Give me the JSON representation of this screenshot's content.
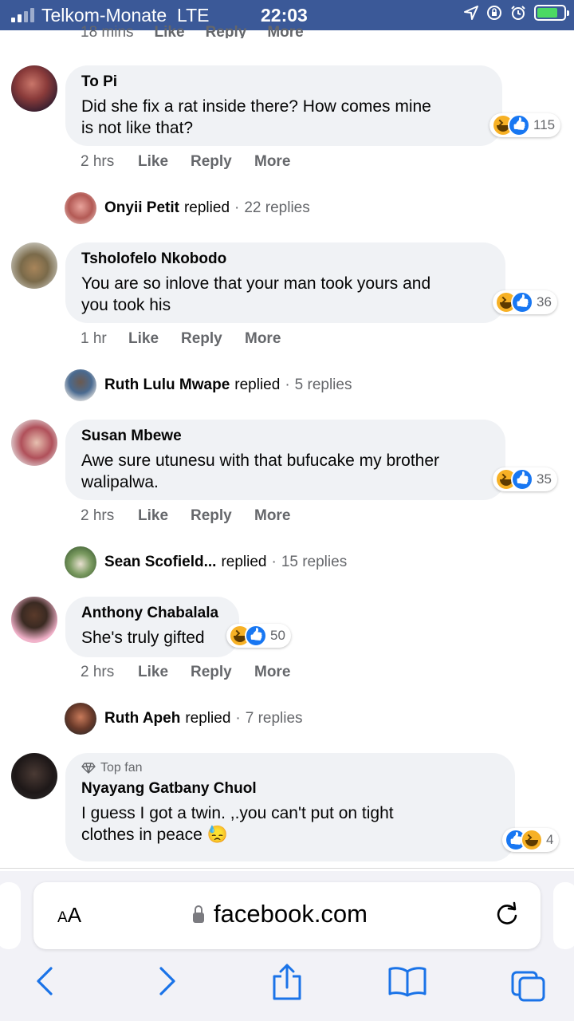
{
  "status_bar": {
    "carrier": "Telkom-Monate",
    "network": "LTE",
    "time": "22:03"
  },
  "cut_top_meta": [
    "18 mins",
    "Like",
    "Reply",
    "More"
  ],
  "comments": [
    {
      "author": "To Pi",
      "text_lines": [
        "Did she fix a rat inside there? How comes mine",
        "is not like that?"
      ],
      "reaction_count": "115",
      "time": "2 hrs",
      "actions": [
        "Like",
        "Reply",
        "More"
      ],
      "reply": {
        "name": "Onyii Petit",
        "verb": "replied",
        "count": "22 replies"
      }
    },
    {
      "author": "Tsholofelo Nkobodo",
      "text_lines": [
        "You are so inlove that your man took yours and",
        "you took his"
      ],
      "reaction_count": "36",
      "time": "1 hr",
      "actions": [
        "Like",
        "Reply",
        "More"
      ],
      "reply": {
        "name": "Ruth Lulu Mwape",
        "verb": "replied",
        "count": "5 replies"
      }
    },
    {
      "author": "Susan Mbewe",
      "text_lines": [
        "Awe sure utunesu with that bufucake my brother",
        "walipalwa."
      ],
      "reaction_count": "35",
      "time": "2 hrs",
      "actions": [
        "Like",
        "Reply",
        "More"
      ],
      "reply": {
        "name": "Sean Scofield...",
        "verb": "replied",
        "count": "15 replies"
      }
    },
    {
      "author": "Anthony Chabalala",
      "text_lines": [
        "She's truly gifted"
      ],
      "reaction_count": "50",
      "time": "2 hrs",
      "actions": [
        "Like",
        "Reply",
        "More"
      ],
      "reply": {
        "name": "Ruth Apeh",
        "verb": "replied",
        "count": "7 replies"
      }
    },
    {
      "badge": "Top fan",
      "author": "Nyayang Gatbany Chuol",
      "text_lines": [
        "I guess I got a twin. ,.you can't put on tight",
        "clothes in peace 😓"
      ],
      "reaction_count": "4"
    }
  ],
  "browser": {
    "aa_label": "A",
    "aa_label_big": "A",
    "url": "facebook.com"
  },
  "icons": [
    "signal-icon",
    "location-icon",
    "rotation-lock-icon",
    "alarm-icon",
    "battery-icon",
    "haha-reaction-icon",
    "like-reaction-icon",
    "diamond-icon",
    "lock-icon",
    "reload-icon",
    "back-icon",
    "forward-icon",
    "share-icon",
    "bookmarks-icon",
    "tabs-icon"
  ],
  "colors": {
    "status_bar": "#3b5998",
    "bubble": "#f0f2f5",
    "accent": "#1877f2",
    "haha": "#f7b125"
  }
}
